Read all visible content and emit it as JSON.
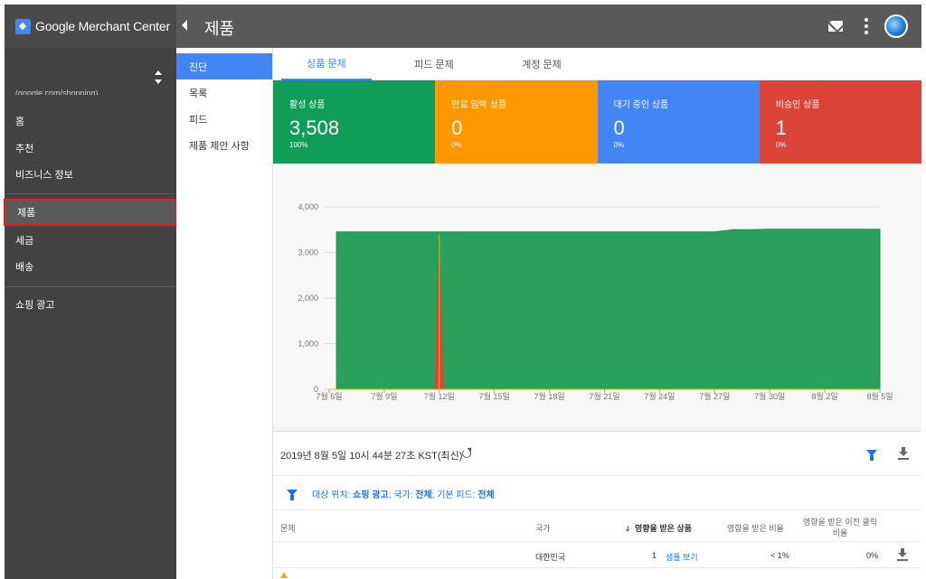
{
  "app": {
    "name": "Google Merchant Center"
  },
  "header": {
    "title": "제품"
  },
  "account": {
    "url": "(google.com/shopping)"
  },
  "leftnav": {
    "items": [
      {
        "label": "홈"
      },
      {
        "label": "추천"
      },
      {
        "label": "비즈니스 정보"
      },
      {
        "label": "제품"
      },
      {
        "label": "세금"
      },
      {
        "label": "배송"
      },
      {
        "label": "쇼핑 광고"
      }
    ]
  },
  "subnav": {
    "items": [
      {
        "label": "진단"
      },
      {
        "label": "목록"
      },
      {
        "label": "피드"
      },
      {
        "label": "제품 제안 사항"
      }
    ]
  },
  "tabs": [
    {
      "label": "상품 문제"
    },
    {
      "label": "피드 문제"
    },
    {
      "label": "계정 문제"
    }
  ],
  "stats": [
    {
      "label": "활성 상품",
      "value": "3,508",
      "pct": "100%",
      "color": "#0f9d58"
    },
    {
      "label": "만료 임박 상품",
      "value": "0",
      "pct": "0%",
      "color": "#ff9800"
    },
    {
      "label": "대기 중인 상품",
      "value": "0",
      "pct": "0%",
      "color": "#4285f4"
    },
    {
      "label": "비승인 상품",
      "value": "1",
      "pct": "0%",
      "color": "#db4437"
    }
  ],
  "chart_data": {
    "type": "area",
    "title": "",
    "xlabel": "",
    "ylabel": "",
    "ylim": [
      0,
      4000
    ],
    "yticks": [
      "0",
      "1,000",
      "2,000",
      "3,000",
      "4,000"
    ],
    "xticks": [
      "7월 6일",
      "7월 9일",
      "7월 12일",
      "7월 15일",
      "7월 18일",
      "7월 21일",
      "7월 24일",
      "7월 27일",
      "7월 30일",
      "8월 2일",
      "8월 5일"
    ],
    "grid": true,
    "legend": "none",
    "x": [
      0,
      0.4,
      1,
      2,
      3,
      4,
      5,
      6,
      7,
      8,
      9,
      10,
      11,
      12,
      13,
      14,
      15,
      16,
      17,
      18,
      19,
      20,
      21,
      22,
      23,
      24,
      25,
      26,
      27,
      28,
      29,
      30
    ],
    "series": [
      {
        "color": "#29a05c",
        "values": [
          3450,
          3450,
          3450,
          3450,
          3450,
          3450,
          3450,
          3450,
          3450,
          3450,
          3450,
          3450,
          3450,
          3450,
          3450,
          3450,
          3450,
          3450,
          3450,
          3450,
          3450,
          3450,
          3450,
          3500,
          3500,
          3510,
          3510,
          3510,
          3510,
          3510,
          3510,
          3508
        ]
      },
      {
        "color": "#db4437",
        "spike": {
          "x": 6,
          "value": 3400
        }
      }
    ]
  },
  "results": {
    "timestamp": "2019년 8월 5일 10시 44분 27초 KST(최신)",
    "filter_prefix": "대상 위치: ",
    "filter_dest": "쇼핑 광고",
    "filter_mid1": "; 국가: ",
    "filter_country": "전체",
    "filter_mid2": "; 기본 피드: ",
    "filter_feed": "전체",
    "columns": {
      "issue": "문제",
      "country": "국가",
      "affected": "영향을 받은 상품",
      "affected_ratio": "영향을 받은 비율",
      "prev_click_ratio_1": "영향을 받은 이전 클릭",
      "prev_click_ratio_2": "비율"
    },
    "rows": [
      {
        "country": "대한민국",
        "count": "1",
        "view": "샘플 보기",
        "ratio": "< 1%",
        "prev": "0%"
      }
    ]
  }
}
